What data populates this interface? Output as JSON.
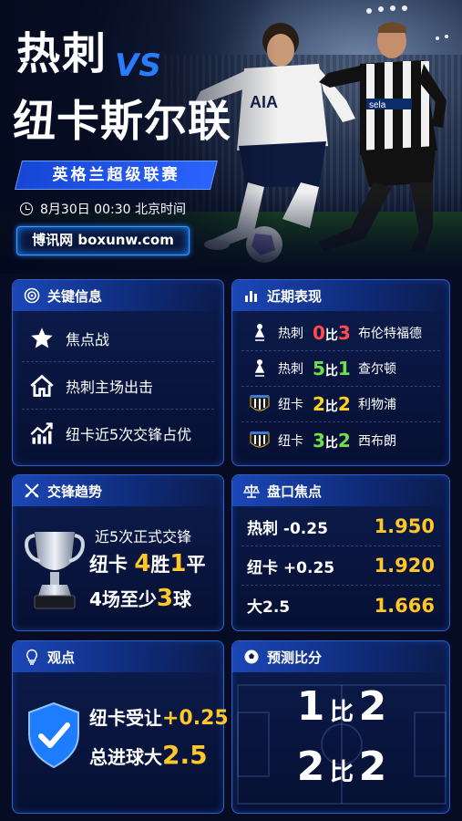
{
  "title": {
    "home": "热刺",
    "vs": "VS",
    "away": "纽卡斯尔联"
  },
  "league": "英格兰超级联赛",
  "time": "8月30日  00:30  北京时间",
  "website": "博讯网 boxunw.com",
  "key_info": {
    "title": "关键信息",
    "items": [
      "焦点战",
      "热刺主场出击",
      "纽卡近5次交锋占优"
    ]
  },
  "recent": {
    "title": "近期表现",
    "rows": [
      {
        "team": "热刺",
        "s1": "0",
        "mid": "比",
        "s2": "3",
        "opp": "布伦特福德",
        "c1": "#ff4a4a",
        "c2": "#ff4a4a"
      },
      {
        "team": "热刺",
        "s1": "5",
        "mid": "比",
        "s2": "1",
        "opp": "查尔顿",
        "c1": "#6fe04a",
        "c2": "#6fe04a"
      },
      {
        "team": "纽卡",
        "s1": "2",
        "mid": "比",
        "s2": "2",
        "opp": "利物浦",
        "c1": "#ffd21f",
        "c2": "#ffd21f"
      },
      {
        "team": "纽卡",
        "s1": "3",
        "mid": "比",
        "s2": "2",
        "opp": "西布朗",
        "c1": "#6fe04a",
        "c2": "#6fe04a"
      }
    ]
  },
  "h2h": {
    "title": "交锋趋势",
    "line1": "近5次正式交锋",
    "l2a": "纽卡",
    "l2b": "4",
    "l2c": "胜",
    "l2d": "1",
    "l2e": "平",
    "l3a": "4场至少",
    "l3b": "3",
    "l3c": "球"
  },
  "handicap": {
    "title": "盘口焦点",
    "rows": [
      {
        "label": "热刺  -0.25",
        "value": "1.950"
      },
      {
        "label": "纽卡  +0.25",
        "value": "1.920"
      },
      {
        "label": "大2.5",
        "value": "1.666"
      }
    ]
  },
  "view": {
    "title": "观点",
    "l1a": "纽卡受让",
    "l1b": "+0.25",
    "l2a": "总进球大",
    "l2b": "2.5"
  },
  "predict": {
    "title": "预测比分",
    "s1a": "1",
    "s1m": "比",
    "s1b": "2",
    "s2a": "2",
    "s2m": "比",
    "s2b": "2"
  },
  "colors": {
    "accent": "#2a7cff",
    "gold": "#ffc727",
    "card_border": "#2f5fc8"
  }
}
